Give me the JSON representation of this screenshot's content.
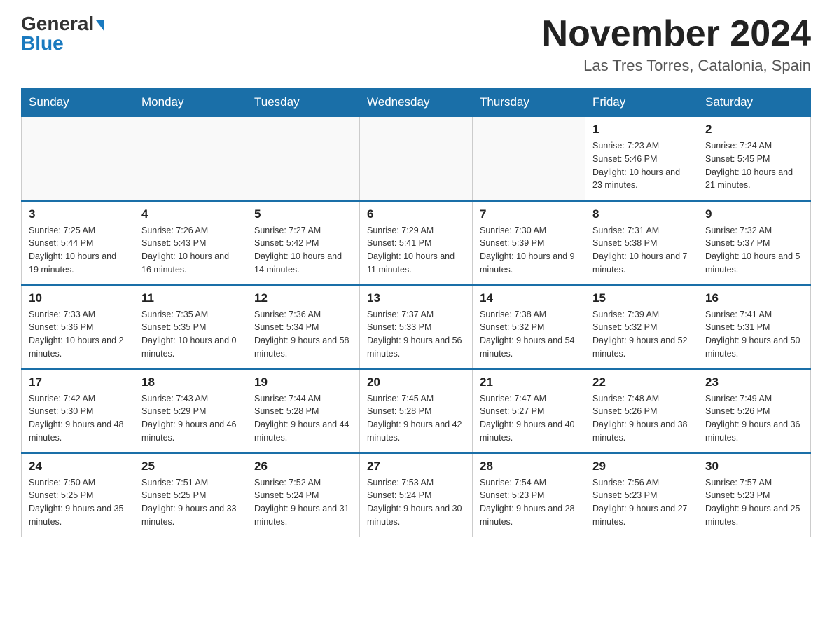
{
  "header": {
    "logo_general": "General",
    "logo_blue": "Blue",
    "title": "November 2024",
    "location": "Las Tres Torres, Catalonia, Spain"
  },
  "days_of_week": [
    "Sunday",
    "Monday",
    "Tuesday",
    "Wednesday",
    "Thursday",
    "Friday",
    "Saturday"
  ],
  "weeks": [
    [
      {
        "day": "",
        "info": ""
      },
      {
        "day": "",
        "info": ""
      },
      {
        "day": "",
        "info": ""
      },
      {
        "day": "",
        "info": ""
      },
      {
        "day": "",
        "info": ""
      },
      {
        "day": "1",
        "info": "Sunrise: 7:23 AM\nSunset: 5:46 PM\nDaylight: 10 hours and 23 minutes."
      },
      {
        "day": "2",
        "info": "Sunrise: 7:24 AM\nSunset: 5:45 PM\nDaylight: 10 hours and 21 minutes."
      }
    ],
    [
      {
        "day": "3",
        "info": "Sunrise: 7:25 AM\nSunset: 5:44 PM\nDaylight: 10 hours and 19 minutes."
      },
      {
        "day": "4",
        "info": "Sunrise: 7:26 AM\nSunset: 5:43 PM\nDaylight: 10 hours and 16 minutes."
      },
      {
        "day": "5",
        "info": "Sunrise: 7:27 AM\nSunset: 5:42 PM\nDaylight: 10 hours and 14 minutes."
      },
      {
        "day": "6",
        "info": "Sunrise: 7:29 AM\nSunset: 5:41 PM\nDaylight: 10 hours and 11 minutes."
      },
      {
        "day": "7",
        "info": "Sunrise: 7:30 AM\nSunset: 5:39 PM\nDaylight: 10 hours and 9 minutes."
      },
      {
        "day": "8",
        "info": "Sunrise: 7:31 AM\nSunset: 5:38 PM\nDaylight: 10 hours and 7 minutes."
      },
      {
        "day": "9",
        "info": "Sunrise: 7:32 AM\nSunset: 5:37 PM\nDaylight: 10 hours and 5 minutes."
      }
    ],
    [
      {
        "day": "10",
        "info": "Sunrise: 7:33 AM\nSunset: 5:36 PM\nDaylight: 10 hours and 2 minutes."
      },
      {
        "day": "11",
        "info": "Sunrise: 7:35 AM\nSunset: 5:35 PM\nDaylight: 10 hours and 0 minutes."
      },
      {
        "day": "12",
        "info": "Sunrise: 7:36 AM\nSunset: 5:34 PM\nDaylight: 9 hours and 58 minutes."
      },
      {
        "day": "13",
        "info": "Sunrise: 7:37 AM\nSunset: 5:33 PM\nDaylight: 9 hours and 56 minutes."
      },
      {
        "day": "14",
        "info": "Sunrise: 7:38 AM\nSunset: 5:32 PM\nDaylight: 9 hours and 54 minutes."
      },
      {
        "day": "15",
        "info": "Sunrise: 7:39 AM\nSunset: 5:32 PM\nDaylight: 9 hours and 52 minutes."
      },
      {
        "day": "16",
        "info": "Sunrise: 7:41 AM\nSunset: 5:31 PM\nDaylight: 9 hours and 50 minutes."
      }
    ],
    [
      {
        "day": "17",
        "info": "Sunrise: 7:42 AM\nSunset: 5:30 PM\nDaylight: 9 hours and 48 minutes."
      },
      {
        "day": "18",
        "info": "Sunrise: 7:43 AM\nSunset: 5:29 PM\nDaylight: 9 hours and 46 minutes."
      },
      {
        "day": "19",
        "info": "Sunrise: 7:44 AM\nSunset: 5:28 PM\nDaylight: 9 hours and 44 minutes."
      },
      {
        "day": "20",
        "info": "Sunrise: 7:45 AM\nSunset: 5:28 PM\nDaylight: 9 hours and 42 minutes."
      },
      {
        "day": "21",
        "info": "Sunrise: 7:47 AM\nSunset: 5:27 PM\nDaylight: 9 hours and 40 minutes."
      },
      {
        "day": "22",
        "info": "Sunrise: 7:48 AM\nSunset: 5:26 PM\nDaylight: 9 hours and 38 minutes."
      },
      {
        "day": "23",
        "info": "Sunrise: 7:49 AM\nSunset: 5:26 PM\nDaylight: 9 hours and 36 minutes."
      }
    ],
    [
      {
        "day": "24",
        "info": "Sunrise: 7:50 AM\nSunset: 5:25 PM\nDaylight: 9 hours and 35 minutes."
      },
      {
        "day": "25",
        "info": "Sunrise: 7:51 AM\nSunset: 5:25 PM\nDaylight: 9 hours and 33 minutes."
      },
      {
        "day": "26",
        "info": "Sunrise: 7:52 AM\nSunset: 5:24 PM\nDaylight: 9 hours and 31 minutes."
      },
      {
        "day": "27",
        "info": "Sunrise: 7:53 AM\nSunset: 5:24 PM\nDaylight: 9 hours and 30 minutes."
      },
      {
        "day": "28",
        "info": "Sunrise: 7:54 AM\nSunset: 5:23 PM\nDaylight: 9 hours and 28 minutes."
      },
      {
        "day": "29",
        "info": "Sunrise: 7:56 AM\nSunset: 5:23 PM\nDaylight: 9 hours and 27 minutes."
      },
      {
        "day": "30",
        "info": "Sunrise: 7:57 AM\nSunset: 5:23 PM\nDaylight: 9 hours and 25 minutes."
      }
    ]
  ]
}
